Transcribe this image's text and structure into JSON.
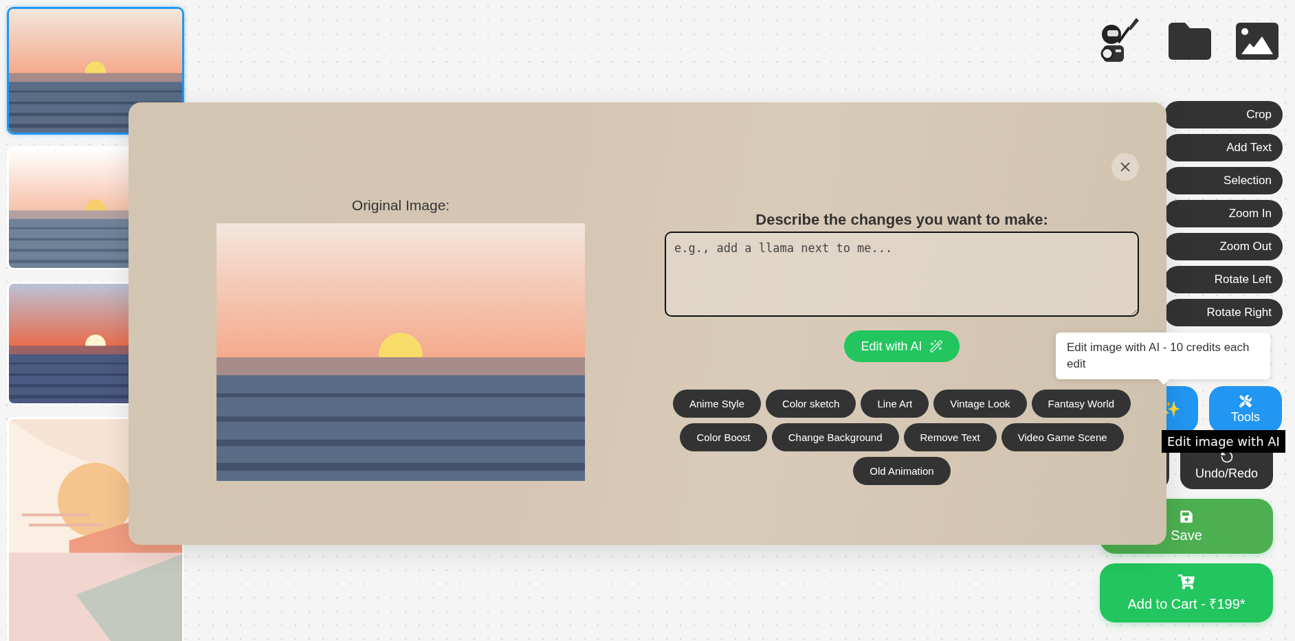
{
  "thumbnails": [
    {
      "selected": true
    },
    {
      "selected": false
    },
    {
      "selected": false
    },
    {
      "selected": false
    }
  ],
  "toolbar": {
    "tools": [
      "Crop",
      "Add Text",
      "Selection",
      "Zoom In",
      "Zoom Out",
      "Rotate Left",
      "Rotate Right"
    ],
    "ai_button": {
      "icon": "✨"
    },
    "tools_button": "Tools",
    "undo_button": "Undo/Redo",
    "save_button": "Save",
    "cart_button": "Add to Cart - ₹199*"
  },
  "tooltips": {
    "ai_credits": "Edit image with AI - 10 credits each edit",
    "edit_hint": "Edit image with AI"
  },
  "modal": {
    "original_label": "Original Image:",
    "prompt_label": "Describe the changes you want to make:",
    "prompt": {
      "placeholder": "e.g., add a llama next to me..."
    },
    "submit": "Edit with AI",
    "presets": [
      "Anime Style",
      "Color sketch",
      "Line Art",
      "Vintage Look",
      "Fantasy World",
      "Color Boost",
      "Change Background",
      "Remove Text",
      "Video Game Scene",
      "Old Animation"
    ]
  }
}
